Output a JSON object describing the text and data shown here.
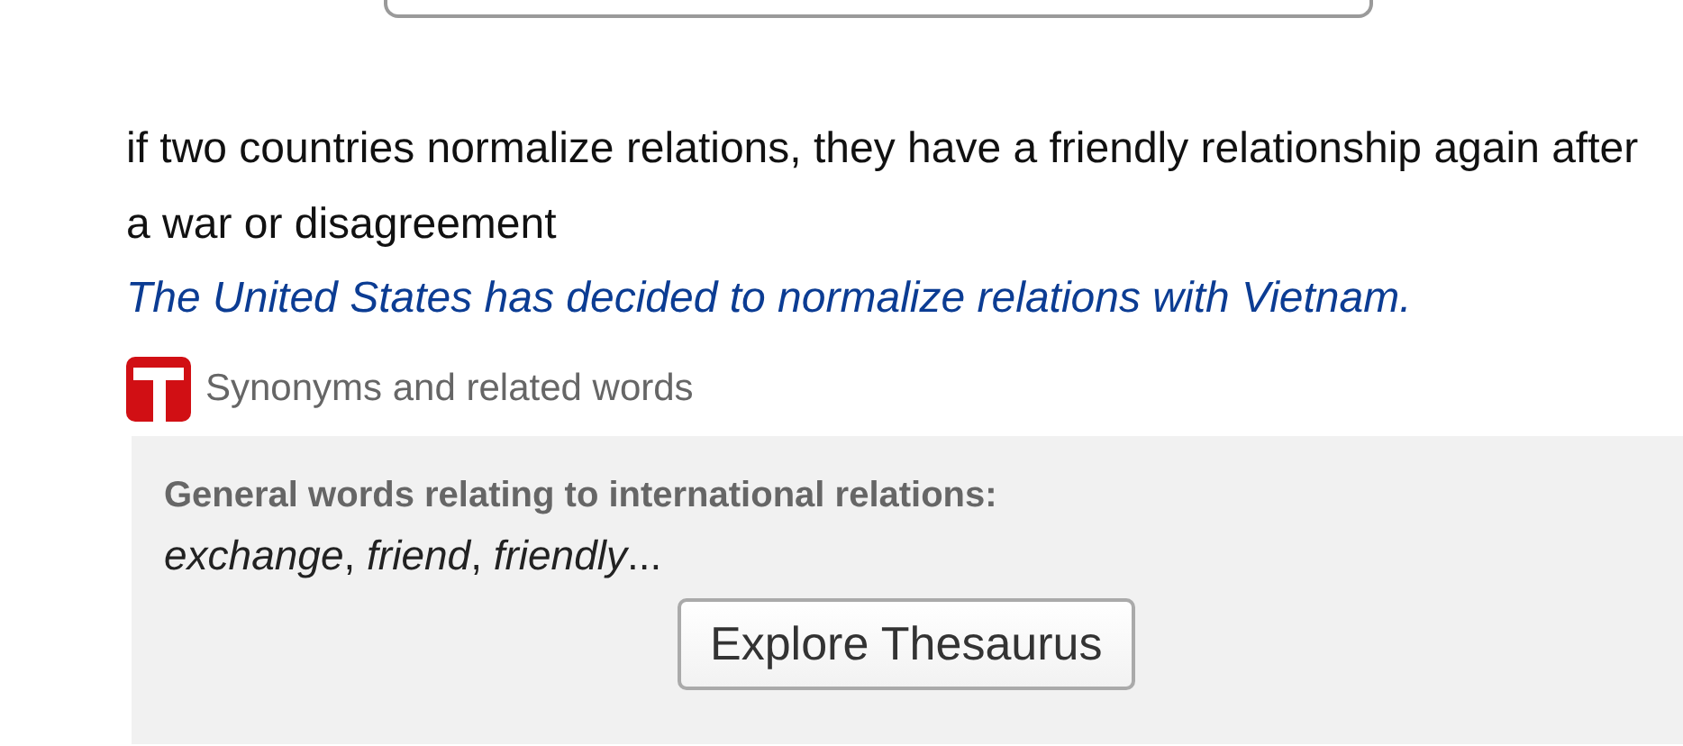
{
  "definition": "if two countries normalize relations, they have a friendly relationship again after a war or disagreement",
  "example": "The United States has decided to normalize relations with Vietnam.",
  "thesaurus": {
    "heading": "Synonyms and related words",
    "panel": {
      "title": "General words relating to international relations:",
      "words": "*exchange*, *friend*, *friendly*...",
      "button": "Explore Thesaurus"
    }
  }
}
